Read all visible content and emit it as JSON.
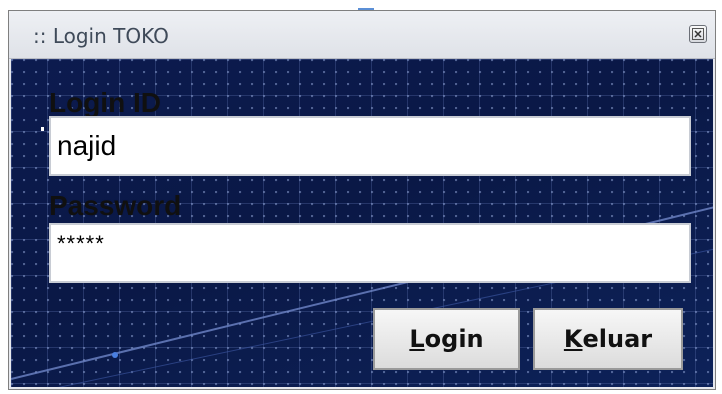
{
  "window": {
    "title": ":: Login TOKO"
  },
  "form": {
    "login_label": "Login ID",
    "login_value": "najid",
    "password_label": "Password",
    "password_value": "*****"
  },
  "buttons": {
    "login_mnemonic": "L",
    "login_rest": "ogin",
    "keluar_mnemonic": "K",
    "keluar_rest": "eluar"
  },
  "icons": {
    "close": "close-icon"
  },
  "colors": {
    "background": "#0c1b4f",
    "titlebar": "#e4e6eb"
  }
}
